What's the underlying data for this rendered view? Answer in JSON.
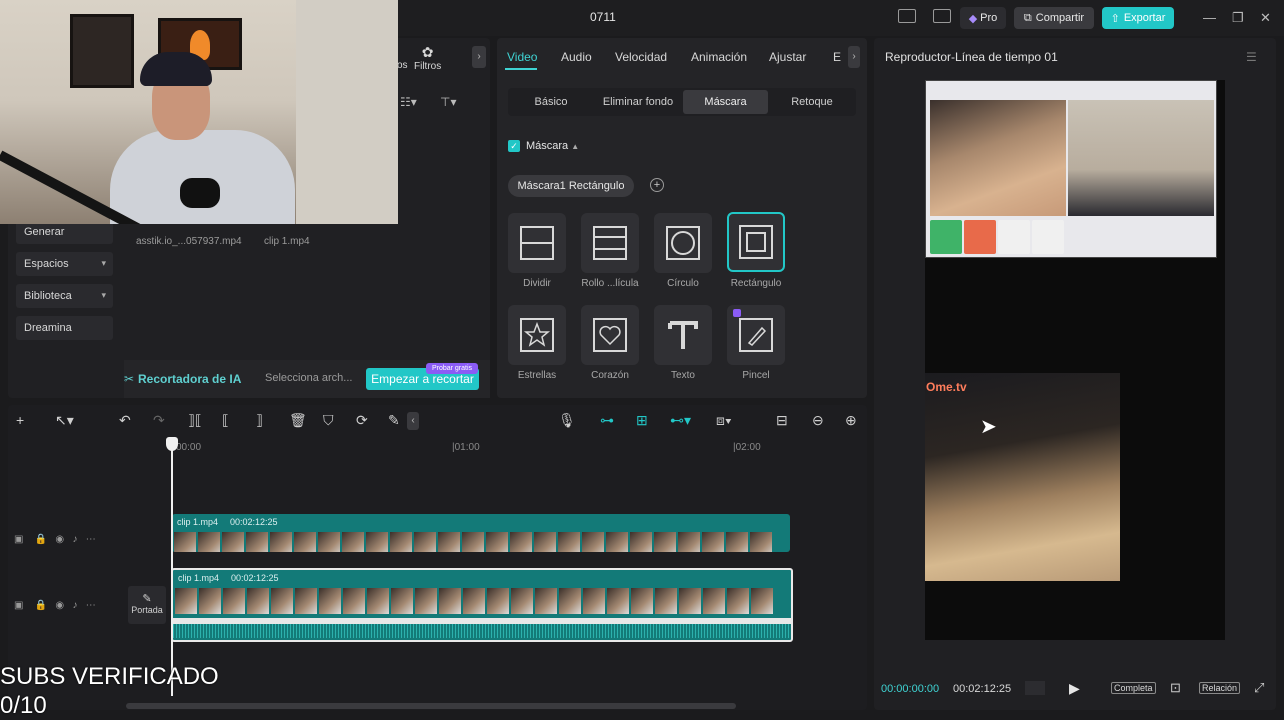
{
  "window": {
    "title": "0711"
  },
  "topbar": {
    "pro_label": "Pro",
    "share_label": "Compartir",
    "export_label": "Exportar"
  },
  "media": {
    "filters_label": "Filtros",
    "partial_tab": "os",
    "sidebar": [
      "Generar",
      "Espacios",
      "Biblioteca",
      "Dreamina"
    ],
    "clips": [
      "asstik.io_...057937.mp4",
      "clip 1.mp4"
    ],
    "ai_cutter": {
      "title": "Recortadora de IA",
      "select": "Selecciona arch...",
      "start": "Empezar a recortar",
      "badge": "Probar gratis"
    }
  },
  "props": {
    "tabs": [
      "Video",
      "Audio",
      "Velocidad",
      "Animación",
      "Ajustar",
      "E"
    ],
    "subtabs": [
      "Básico",
      "Eliminar fondo",
      "Máscara",
      "Retoque"
    ],
    "mask_toggle": "Máscara",
    "mask_chip": "Máscara1 Rectángulo",
    "shapes": [
      "Dividir",
      "Rollo ...lícula",
      "Círculo",
      "Rectángulo",
      "Estrellas",
      "Corazón",
      "Texto",
      "Pincel"
    ],
    "selected_shape": "Rectángulo"
  },
  "player": {
    "title": "Reproductor-Línea de tiempo 01",
    "time_current": "00:00:00:00",
    "time_total": "00:02:12:25",
    "full_label": "Completa",
    "ratio_label": "Relación",
    "ome_logo": "Ome.tv"
  },
  "timeline": {
    "ruler": [
      "00:00",
      "01:00",
      "02:00"
    ],
    "clip_top": {
      "name": "clip 1.mp4",
      "duration": "00:02:12:25"
    },
    "clip_bottom": {
      "name": "clip 1.mp4",
      "duration": "00:02:12:25"
    },
    "cover_label": "Portada"
  },
  "overlay": {
    "line1": "SUBS VERIFICADO",
    "line2": "0/10"
  },
  "colors": {
    "accent": "#22c7c7",
    "panel": "#242427",
    "background": "#1b1b1d"
  }
}
